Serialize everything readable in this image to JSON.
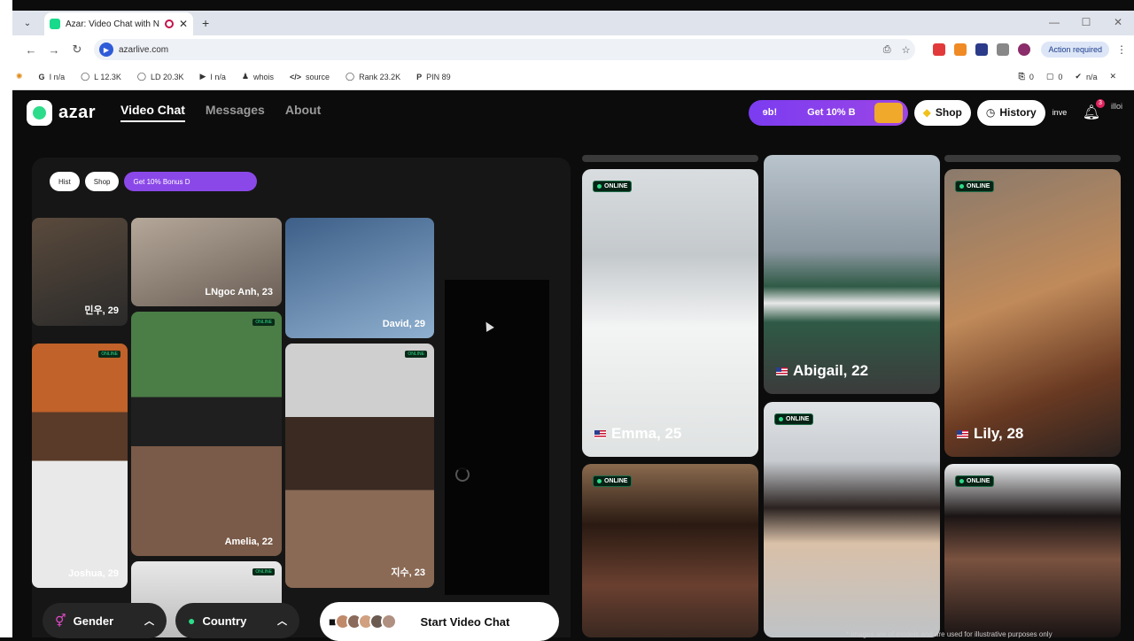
{
  "browser": {
    "tab_title": "Azar: Video Chat with New",
    "tab_close": "✕",
    "new_tab": "+",
    "url": "azarlive.com",
    "action_required": "Action required",
    "win_min": "—",
    "win_max": "☐",
    "win_close": "✕"
  },
  "seo_bar": {
    "items": [
      {
        "icon": "G",
        "label": "I n/a"
      },
      {
        "icon": "◯",
        "label": "L 12.3K"
      },
      {
        "icon": "◯",
        "label": "LD 20.3K"
      },
      {
        "icon": "▶",
        "label": "I n/a"
      },
      {
        "icon": "♟",
        "label": "whois"
      },
      {
        "icon": "</>",
        "label": "source"
      },
      {
        "icon": "◯",
        "label": "Rank 23.2K"
      },
      {
        "icon": "P",
        "label": "PIN 89"
      }
    ],
    "right_items": [
      {
        "icon": "⎘",
        "label": "0"
      },
      {
        "icon": "▢",
        "label": "0"
      },
      {
        "icon": "✔",
        "label": "n/a"
      }
    ]
  },
  "header": {
    "logo_text": "azar",
    "nav": [
      "Video Chat",
      "Messages",
      "About"
    ],
    "promo_text_1": "ɘb!",
    "promo_text_2": "Get 10% B",
    "shop": "Shop",
    "history": "History",
    "img_alt_1": "inve",
    "img_alt_2": "illoi",
    "notification_count": "3"
  },
  "hero": {
    "top_pills": [
      "Hist",
      "Shop",
      "Get 10% Bonus D"
    ],
    "captions": [
      "민우, 29",
      "LNgoc Anh, 23",
      "David, 29",
      "Joshua, 29",
      "Amelia, 22",
      "지수, 23"
    ],
    "online_label": "ONLINE"
  },
  "profiles": [
    {
      "name": "Emma, 25",
      "status": "ONLINE"
    },
    {
      "name": "Abigail, 22",
      "status": ""
    },
    {
      "name": "Lily, 28",
      "status": "ONLINE"
    },
    {
      "name": "",
      "status": "ONLINE"
    },
    {
      "name": "",
      "status": "ONLINE"
    },
    {
      "name": "",
      "status": "ONLINE"
    }
  ],
  "controls": {
    "gender": "Gender",
    "country": "Country",
    "start": "Start Video Chat"
  },
  "footnote": "* Images are of models and are used for illustrative purposes only",
  "colors": {
    "accent": "#2ddc8a",
    "promo": "#8b48e8",
    "notification": "#e0245e"
  }
}
